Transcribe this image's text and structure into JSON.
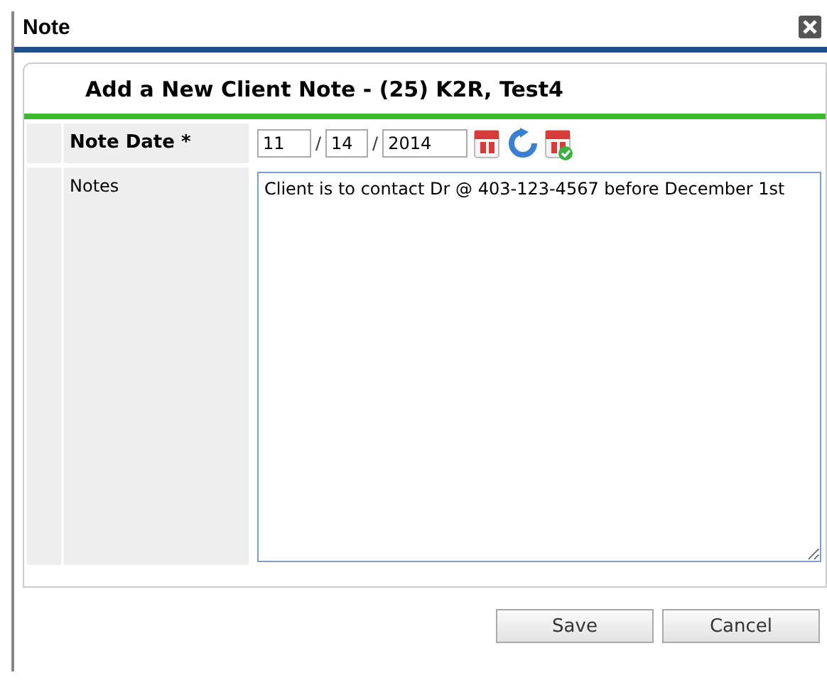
{
  "window": {
    "title": "Note"
  },
  "form": {
    "title": "Add a New Client Note - (25) K2R, Test4",
    "date_field": {
      "label": "Note Date",
      "required_mark": "*",
      "month": "11",
      "day": "14",
      "year": "2014",
      "separators": [
        "/",
        "/"
      ]
    },
    "notes_field": {
      "label": "Notes",
      "value": "Client is to contact Dr @ 403-123-4567 before December 1st"
    }
  },
  "buttons": [
    "Save",
    "Cancel"
  ]
}
